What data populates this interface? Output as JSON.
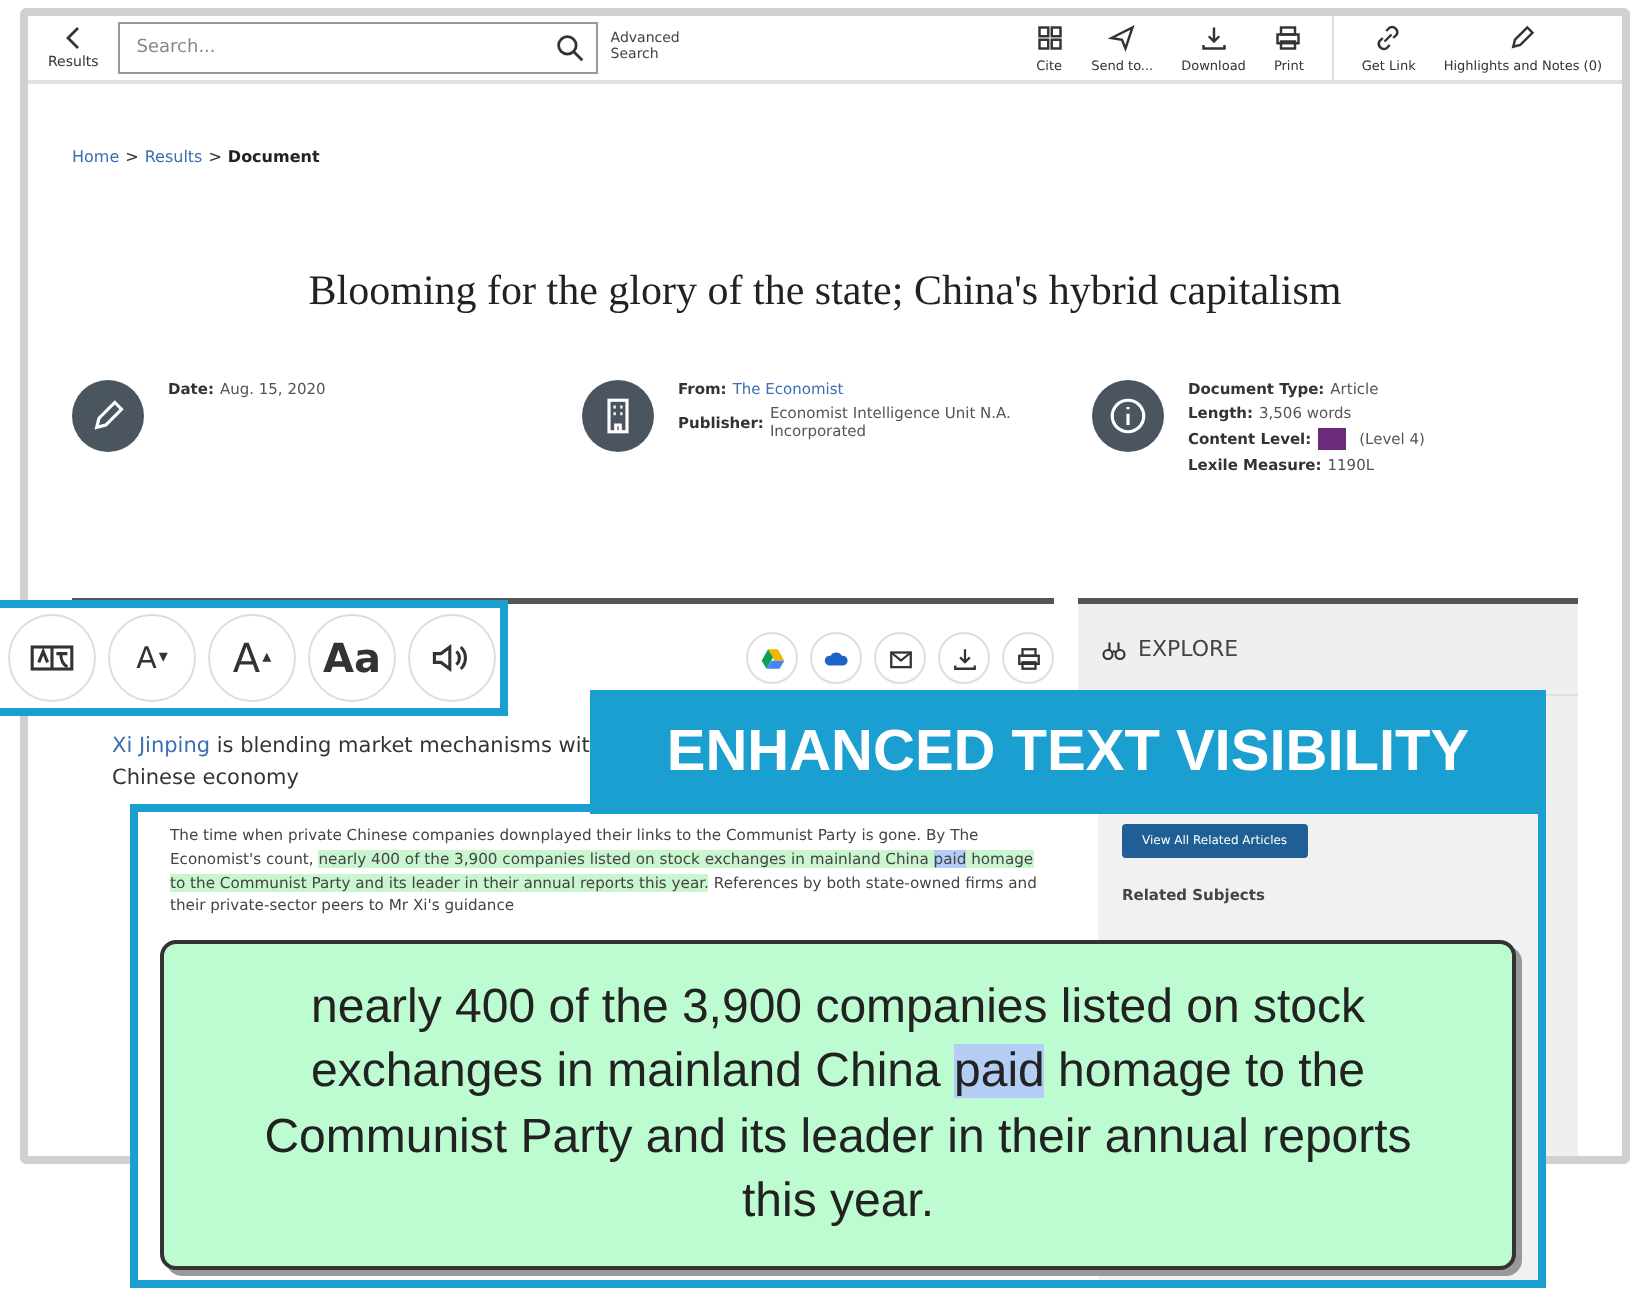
{
  "toolbar": {
    "back_label": "Results",
    "search": {
      "placeholder": "Search..."
    },
    "advanced": "Advanced Search",
    "actions": [
      {
        "kind": "cite",
        "label": "Cite"
      },
      {
        "kind": "send",
        "label": "Send to..."
      },
      {
        "kind": "download",
        "label": "Download"
      },
      {
        "kind": "print",
        "label": "Print"
      }
    ],
    "link_actions": [
      {
        "kind": "link",
        "label": "Get Link"
      },
      {
        "kind": "pen",
        "label": "Highlights and Notes (0)"
      }
    ]
  },
  "breadcrumb": {
    "separator": ">",
    "items": [
      {
        "label": "Home",
        "current": false
      },
      {
        "label": "Results",
        "current": false
      },
      {
        "label": "Document",
        "current": true
      }
    ]
  },
  "title": "Blooming for the glory of the state; China's hybrid capitalism",
  "meta": [
    {
      "kind": "pen",
      "fields": [
        {
          "label": "Date:",
          "value": "Aug. 15, 2020"
        }
      ]
    },
    {
      "kind": "building",
      "fields": [
        {
          "label": "From:",
          "value": "The Economist",
          "link": true
        },
        {
          "label": "Publisher:",
          "value": "Economist Intelligence Unit N.A. Incorporated"
        }
      ]
    },
    {
      "kind": "info",
      "fields": [
        {
          "label": "Document Type:",
          "value": "Article"
        },
        {
          "label": "Length:",
          "value": "3,506 words"
        },
        {
          "label": "Content Level:",
          "value": "(Level 4)",
          "badge": true
        },
        {
          "label": "Lexile Measure:",
          "value": "1190L"
        }
      ]
    }
  ],
  "share_tools": [
    {
      "kind": "drive"
    },
    {
      "kind": "cloud"
    },
    {
      "kind": "mail"
    },
    {
      "kind": "download"
    },
    {
      "kind": "print"
    }
  ],
  "article": {
    "link": "Xi Jinping",
    "text": " is blending market mechanisms wit",
    "line2": "Chinese economy"
  },
  "sidebar": {
    "heading": "EXPLORE",
    "button": "View All Related Articles",
    "subheading": "Related Subjects"
  },
  "text_tools": [
    {
      "kind": "translate"
    },
    {
      "kind": "smaller",
      "label": "A",
      "mark": "▾"
    },
    {
      "kind": "larger",
      "label": "A",
      "mark": "▴"
    },
    {
      "kind": "contrast",
      "label": "Aa"
    },
    {
      "kind": "audio"
    }
  ],
  "banner": "ENHANCED TEXT VISIBILITY",
  "excerpt": [
    {
      "kind": "plain",
      "text": "The time when private Chinese companies downplayed their links to the Communist Party is gone. By The Economist's count, "
    },
    {
      "kind": "highlight",
      "text": "nearly 400 of the 3,900 companies listed on stock exchanges in mainland China "
    },
    {
      "kind": "selected",
      "text": "paid"
    },
    {
      "kind": "highlight",
      "text": " homage to the Communist Party and its leader in their annual reports this year."
    },
    {
      "kind": "plain",
      "text": " References by both state-owned firms and their private-sector peers to Mr Xi's guidance"
    }
  ],
  "callout": [
    {
      "kind": "plain",
      "text": "nearly 400 of the 3,900 companies listed on stock exchanges in mainland China "
    },
    {
      "kind": "selected",
      "text": "paid"
    },
    {
      "kind": "plain",
      "text": " homage to the Communist Party and its leader in their annual reports this year."
    }
  ]
}
